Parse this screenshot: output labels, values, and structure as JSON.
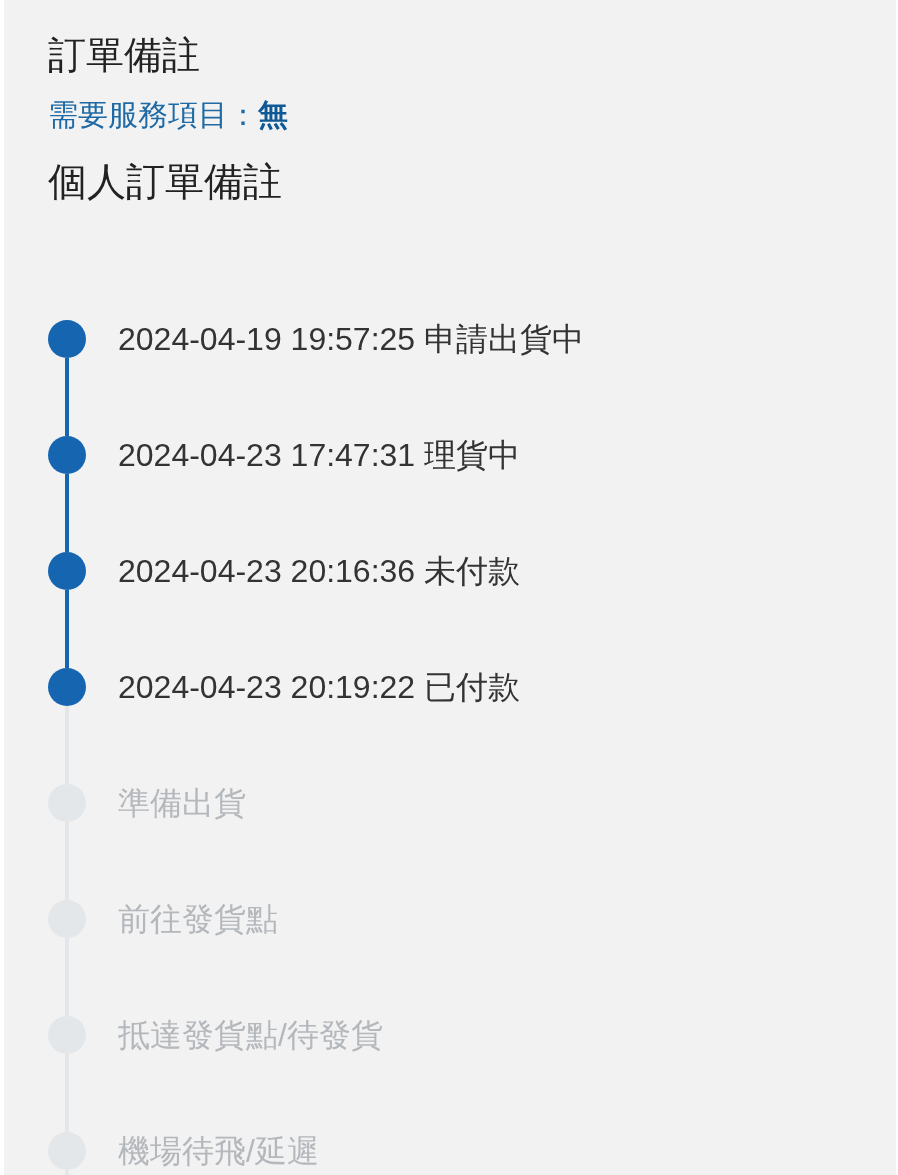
{
  "title": "訂單備註",
  "service_line": "需要服務項目：**無**",
  "personal_note_title": "個人訂單備註",
  "timeline": [
    {
      "time": "2024-04-19 19:57:25",
      "status": "申請出貨中",
      "done": true
    },
    {
      "time": "2024-04-23 17:47:31",
      "status": "理貨中",
      "done": true
    },
    {
      "time": "2024-04-23 20:16:36",
      "status": "未付款",
      "done": true
    },
    {
      "time": "2024-04-23 20:19:22",
      "status": "已付款",
      "done": true
    },
    {
      "status": "準備出貨",
      "done": false
    },
    {
      "status": "前往發貨點",
      "done": false
    },
    {
      "status": "抵達發貨點/待發貨",
      "done": false
    },
    {
      "status": "機場待飛/延遲",
      "done": false
    }
  ]
}
